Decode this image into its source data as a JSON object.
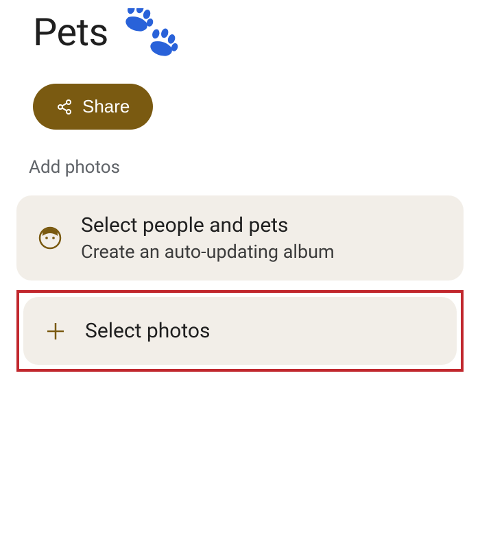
{
  "header": {
    "title": "Pets"
  },
  "actions": {
    "share_label": "Share"
  },
  "section": {
    "label": "Add photos"
  },
  "options": {
    "people_pets": {
      "title": "Select people and pets",
      "subtitle": "Create an auto-updating album"
    },
    "select_photos": {
      "title": "Select photos"
    }
  },
  "colors": {
    "accent_paw": "#2962d9",
    "share_bg": "#7a5a11",
    "card_bg": "#f2eee8",
    "highlight": "#c1272d",
    "icon_olive": "#7a5a11"
  }
}
